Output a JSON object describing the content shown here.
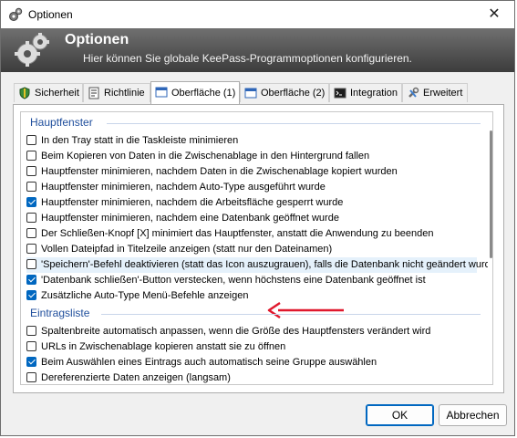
{
  "window": {
    "title": "Optionen",
    "close_glyph": "✕"
  },
  "banner": {
    "title": "Optionen",
    "subtitle": "Hier können Sie globale KeePass-Programmoptionen konfigurieren."
  },
  "tabs": [
    {
      "label": "Sicherheit",
      "icon": "shield-icon",
      "active": false
    },
    {
      "label": "Richtlinie",
      "icon": "policy-icon",
      "active": false
    },
    {
      "label": "Oberfläche (1)",
      "icon": "window-icon",
      "active": true
    },
    {
      "label": "Oberfläche (2)",
      "icon": "window-icon",
      "active": false
    },
    {
      "label": "Integration",
      "icon": "terminal-icon",
      "active": false
    },
    {
      "label": "Erweitert",
      "icon": "tools-icon",
      "active": false
    }
  ],
  "sections": {
    "main": {
      "title": "Hauptfenster",
      "items": [
        {
          "label": "In den Tray statt in die Taskleiste minimieren",
          "checked": false
        },
        {
          "label": "Beim Kopieren von Daten in die Zwischenablage in den Hintergrund fallen",
          "checked": false
        },
        {
          "label": "Hauptfenster minimieren, nachdem Daten in die Zwischenablage kopiert wurden",
          "checked": false
        },
        {
          "label": "Hauptfenster minimieren, nachdem Auto-Type ausgeführt wurde",
          "checked": false
        },
        {
          "label": "Hauptfenster minimieren, nachdem die Arbeitsfläche gesperrt wurde",
          "checked": true
        },
        {
          "label": "Hauptfenster minimieren, nachdem eine Datenbank geöffnet wurde",
          "checked": false
        },
        {
          "label": "Der Schließen-Knopf [X] minimiert das Hauptfenster, anstatt die Anwendung zu beenden",
          "checked": false
        },
        {
          "label": "Vollen Dateipfad in Titelzeile anzeigen (statt nur den Dateinamen)",
          "checked": false
        },
        {
          "label": "'Speichern'-Befehl deaktivieren (statt das Icon auszugrauen), falls die Datenbank nicht geändert wurde",
          "checked": false
        },
        {
          "label": "'Datenbank schließen'-Button verstecken, wenn höchstens eine Datenbank geöffnet ist",
          "checked": true
        },
        {
          "label": "Zusätzliche Auto-Type Menü-Befehle anzeigen",
          "checked": true
        }
      ]
    },
    "entries": {
      "title": "Eintragsliste",
      "items": [
        {
          "label": "Spaltenbreite automatisch anpassen, wenn die Größe des Hauptfensters verändert wird",
          "checked": false
        },
        {
          "label": "URLs in Zwischenablage kopieren anstatt sie zu öffnen",
          "checked": false
        },
        {
          "label": "Beim Auswählen eines Eintrags auch automatisch seine Gruppe auswählen",
          "checked": true
        },
        {
          "label": "Dereferenzierte Daten anzeigen (langsam)",
          "checked": false
        }
      ]
    }
  },
  "highlighted_item": "'Speichern'-Befehl deaktivieren (statt das Icon auszugrauen), falls die Datenbank nicht geändert wurde",
  "buttons": {
    "ok": "OK",
    "cancel": "Abbrechen"
  },
  "colors": {
    "accent": "#0067c0",
    "section_header": "#1f4e9c",
    "annotation_arrow": "#e0182d"
  }
}
